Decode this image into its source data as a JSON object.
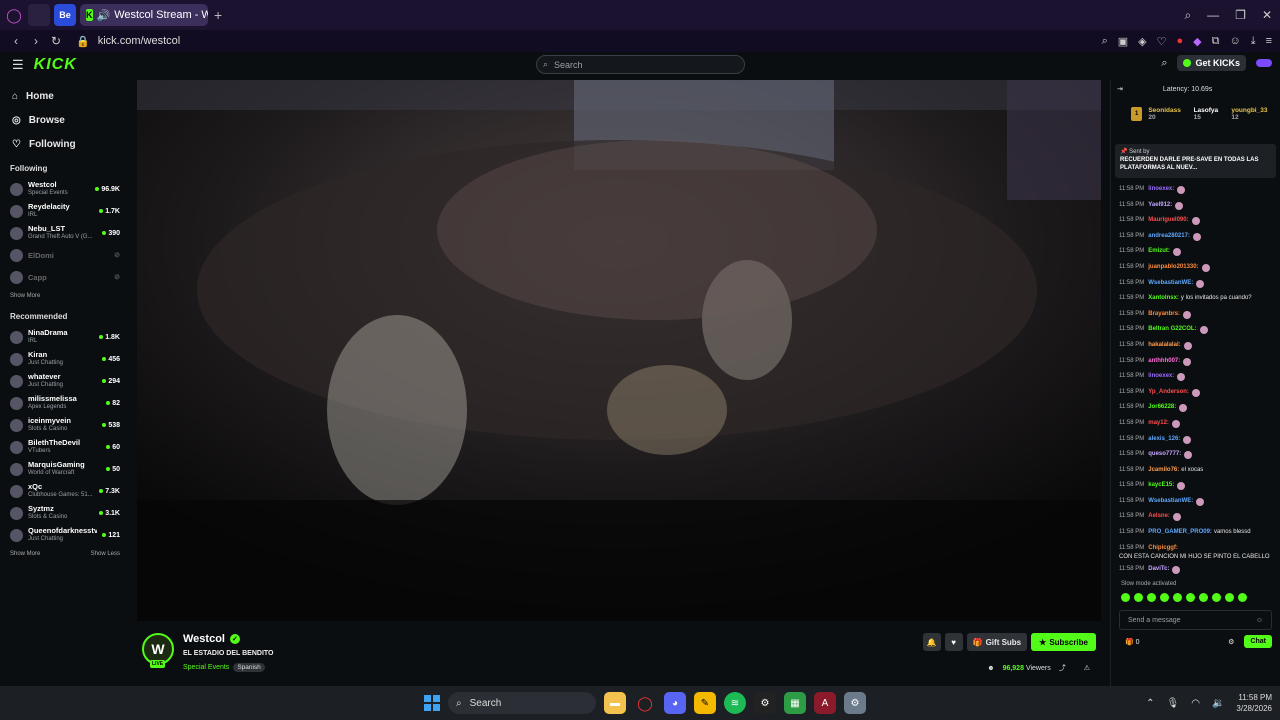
{
  "browser": {
    "tab_title": "Westcol Stream - Watc",
    "url": "kick.com/westcol",
    "pinned_tab_label": "Be"
  },
  "header": {
    "logo": "KICK",
    "search_placeholder": "Search",
    "get_kicks": "Get KICKs"
  },
  "sidebar": {
    "nav": [
      "Home",
      "Browse",
      "Following"
    ],
    "following_title": "Following",
    "following": [
      {
        "name": "Westcol",
        "category": "Special Events",
        "viewers": "96.9K"
      },
      {
        "name": "Reydelacity",
        "category": "IRL",
        "viewers": "1.7K"
      },
      {
        "name": "Nebu_LST",
        "category": "Grand Theft Auto V (G...",
        "viewers": "390"
      },
      {
        "name": "ElDomi",
        "category": "",
        "viewers": ""
      },
      {
        "name": "Capp",
        "category": "",
        "viewers": ""
      }
    ],
    "show_more": "Show More",
    "recommended_title": "Recommended",
    "recommended": [
      {
        "name": "NinaDrama",
        "category": "IRL",
        "viewers": "1.8K"
      },
      {
        "name": "Kiran",
        "category": "Just Chatting",
        "viewers": "456"
      },
      {
        "name": "whatever",
        "category": "Just Chatting",
        "viewers": "294"
      },
      {
        "name": "milissmelissa",
        "category": "Apex Legends",
        "viewers": "82"
      },
      {
        "name": "iceinmyvein",
        "category": "Slots & Casino",
        "viewers": "538"
      },
      {
        "name": "BilethTheDevil",
        "category": "VTubers",
        "viewers": "60"
      },
      {
        "name": "MarquisGaming",
        "category": "World of Warcraft",
        "viewers": "50"
      },
      {
        "name": "xQc",
        "category": "Clubhouse Games: 51...",
        "viewers": "7.3K"
      },
      {
        "name": "Syztmz",
        "category": "Slots & Casino",
        "viewers": "3.1K"
      },
      {
        "name": "Queenofdarknesstv",
        "category": "Just Chatting",
        "viewers": "121"
      }
    ],
    "show_more_2": "Show More",
    "show_less": "Show Less"
  },
  "stream": {
    "streamer": "Westcol",
    "title": "EL ESTADIO DEL BENDITO",
    "category": "Special Events",
    "language": "Spanish",
    "viewers": "96,928",
    "viewers_label": "Viewers",
    "gift_subs": "Gift Subs",
    "subscribe": "Subscribe",
    "live": "LIVE"
  },
  "chat": {
    "latency": "Latency: 10.69s",
    "gifters": [
      {
        "name": "Seonidass",
        "count": "20"
      },
      {
        "name": "Lasofya",
        "count": "15"
      },
      {
        "name": "youngbi_33",
        "count": "12"
      }
    ],
    "pinned_sent_by": "Sent by",
    "pinned_message": "RECUERDEN DARLE PRE-SAVE EN TODAS LAS PLATAFORMAS AL NUEV...",
    "messages": [
      {
        "time": "11:58 PM",
        "user": "linoexex:",
        "text": "",
        "color": "#9b6bff"
      },
      {
        "time": "11:58 PM",
        "user": "Yael912:",
        "text": "",
        "color": "#c6a5ff"
      },
      {
        "time": "11:58 PM",
        "user": "Mauriguel090:",
        "text": "",
        "color": "#ff4d4d"
      },
      {
        "time": "11:58 PM",
        "user": "andrea280217:",
        "text": "",
        "color": "#5fa8ff"
      },
      {
        "time": "11:58 PM",
        "user": "Emizut:",
        "text": "",
        "color": "#53fc18"
      },
      {
        "time": "11:58 PM",
        "user": "juanpablo201330:",
        "text": "",
        "color": "#ff8c3a"
      },
      {
        "time": "11:58 PM",
        "user": "WsebastianWE:",
        "text": "",
        "color": "#5fa8ff"
      },
      {
        "time": "11:58 PM",
        "user": "Xantolnsx:",
        "text": "y los invitados pa cuando?",
        "color": "#53fc18"
      },
      {
        "time": "11:58 PM",
        "user": "Brayanbrs:",
        "text": "",
        "color": "#ff8c3a"
      },
      {
        "time": "11:58 PM",
        "user": "Beltran G22COL:",
        "text": "",
        "color": "#53fc18"
      },
      {
        "time": "11:58 PM",
        "user": "hakalalalal:",
        "text": "",
        "color": "#ff9e4d"
      },
      {
        "time": "11:58 PM",
        "user": "anthhh007:",
        "text": "",
        "color": "#ff6fd8"
      },
      {
        "time": "11:58 PM",
        "user": "linoexex:",
        "text": "",
        "color": "#9b6bff"
      },
      {
        "time": "11:58 PM",
        "user": "Yp_Anderson:",
        "text": "",
        "color": "#ff4d4d"
      },
      {
        "time": "11:58 PM",
        "user": "Jor66228:",
        "text": "",
        "color": "#53fc18"
      },
      {
        "time": "11:58 PM",
        "user": "may12:",
        "text": "",
        "color": "#ff4d4d"
      },
      {
        "time": "11:58 PM",
        "user": "alexis_126:",
        "text": "",
        "color": "#5fa8ff"
      },
      {
        "time": "11:58 PM",
        "user": "queso7777:",
        "text": "",
        "color": "#c6a5ff"
      },
      {
        "time": "11:58 PM",
        "user": "Jcamilo76:",
        "text": "el xocas",
        "color": "#ff9e4d"
      },
      {
        "time": "11:58 PM",
        "user": "kaycE15:",
        "text": "",
        "color": "#53fc18"
      },
      {
        "time": "11:58 PM",
        "user": "WsebastianWE:",
        "text": "",
        "color": "#5fa8ff"
      },
      {
        "time": "11:58 PM",
        "user": "Aelsne:",
        "text": "",
        "color": "#ff4d4d"
      },
      {
        "time": "11:58 PM",
        "user": "PRO_GAMER_PRO09:",
        "text": "vamos blessd",
        "color": "#5fa8ff"
      },
      {
        "time": "11:58 PM",
        "user": "Chipicggf:",
        "text": "CON ESTA CANCION MI HIJO SE PINTO EL CABELLO",
        "color": "#ff8c3a"
      },
      {
        "time": "11:58 PM",
        "user": "DaviTc:",
        "text": "",
        "color": "#c6a5ff"
      }
    ],
    "slow_mode": "Slow mode activated",
    "input_placeholder": "Send a message",
    "kicks_count": "0",
    "chat_button": "Chat"
  },
  "taskbar": {
    "search": "Search",
    "time": "11:58 PM",
    "date": "3/28/2026"
  }
}
